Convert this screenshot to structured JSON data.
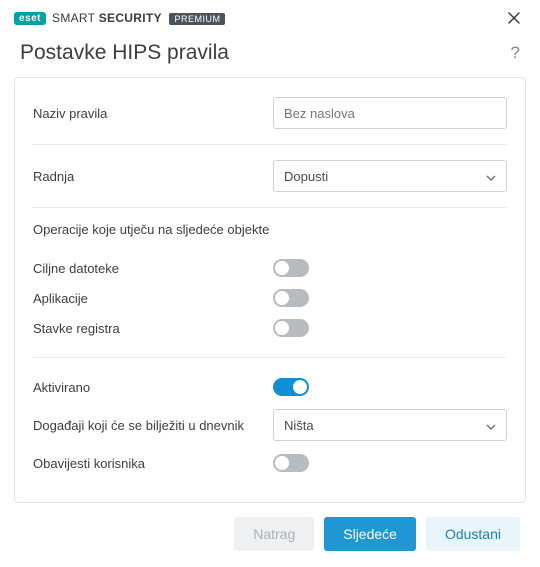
{
  "brand": {
    "badge": "eset",
    "name_thin": "SMART",
    "name_bold": "SECURITY",
    "premium": "PREMIUM"
  },
  "header": {
    "title": "Postavke HIPS pravila"
  },
  "fields": {
    "rule_name": {
      "label": "Naziv pravila",
      "placeholder": "Bez naslova",
      "value": ""
    },
    "action": {
      "label": "Radnja",
      "value": "Dopusti"
    }
  },
  "ops": {
    "title": "Operacije koje utječu na sljedeće objekte",
    "items": [
      {
        "label": "Ciljne datoteke",
        "on": false
      },
      {
        "label": "Aplikacije",
        "on": false
      },
      {
        "label": "Stavke registra",
        "on": false
      }
    ]
  },
  "more": {
    "enabled": {
      "label": "Aktivirano",
      "on": true
    },
    "log": {
      "label": "Događaji koji će se bilježiti u dnevnik",
      "value": "Ništa"
    },
    "notify": {
      "label": "Obavijesti korisnika",
      "on": false
    }
  },
  "footer": {
    "back": "Natrag",
    "next": "Sljedeće",
    "cancel": "Odustani"
  }
}
